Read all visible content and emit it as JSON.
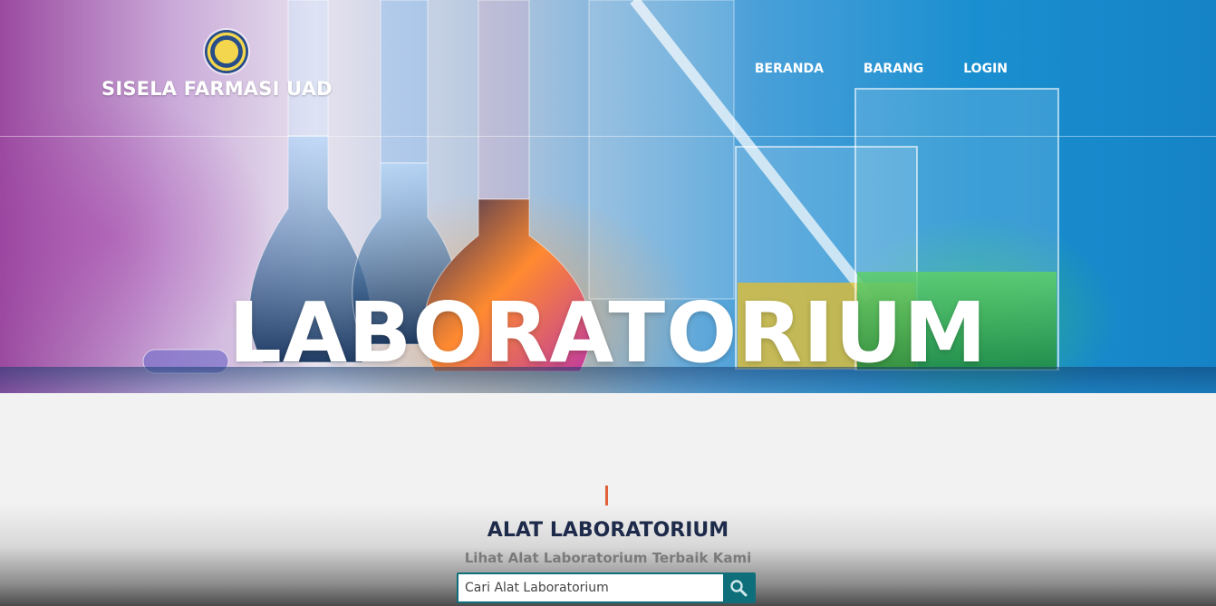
{
  "brand": {
    "name": "SISELA FARMASI UAD"
  },
  "nav": {
    "items": [
      "BERANDA",
      "BARANG",
      "LOGIN"
    ]
  },
  "hero": {
    "title": "LABORATORIUM"
  },
  "section": {
    "title": "ALAT LABORATORIUM",
    "subtitle": "Lihat Alat Laboratorium Terbaik Kami"
  },
  "search": {
    "placeholder": "Cari Alat Laboratorium",
    "value": ""
  },
  "icons": {
    "search": "search-icon",
    "logo": "university-seal-logo"
  },
  "colors": {
    "accent": "#e0623c",
    "title": "#1d2a4a",
    "search": "#0e6f7a"
  }
}
